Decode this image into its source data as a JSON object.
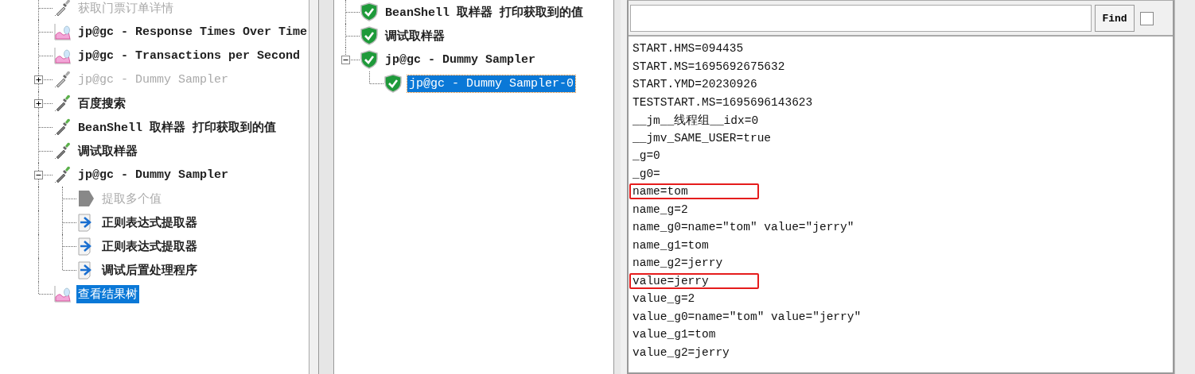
{
  "test_plan_tree": {
    "items": [
      {
        "kind": "dropper",
        "label": "获取门票订单详情",
        "disabled": true
      },
      {
        "kind": "chart",
        "label": "jp@gc - Response Times Over Time",
        "disabled": false
      },
      {
        "kind": "chart",
        "label": "jp@gc - Transactions per Second",
        "disabled": false
      },
      {
        "kind": "dropper",
        "label": "jp@gc - Dummy Sampler",
        "disabled": true,
        "expanded": false
      },
      {
        "kind": "dropper",
        "label": "百度搜索",
        "disabled": false,
        "expanded": false
      },
      {
        "kind": "dropper",
        "label": "BeanShell 取样器 打印获取到的值",
        "disabled": false
      },
      {
        "kind": "dropper",
        "label": "调试取样器",
        "disabled": false
      },
      {
        "kind": "dropper",
        "label": "jp@gc - Dummy Sampler",
        "disabled": false,
        "expanded": true,
        "children": [
          {
            "kind": "extractor",
            "label": "提取多个值",
            "disabled": true
          },
          {
            "kind": "extractor",
            "label": "正则表达式提取器",
            "disabled": false
          },
          {
            "kind": "extractor",
            "label": "正则表达式提取器",
            "disabled": false
          },
          {
            "kind": "extractor",
            "label": "调试后置处理程序",
            "disabled": false
          }
        ]
      },
      {
        "kind": "chart",
        "label": "查看结果树",
        "disabled": false,
        "selected": true
      }
    ]
  },
  "results_tree": {
    "items": [
      {
        "kind": "success",
        "label": "BeanShell 取样器 打印获取到的值"
      },
      {
        "kind": "success",
        "label": "调试取样器"
      },
      {
        "kind": "success",
        "label": "jp@gc - Dummy Sampler",
        "expanded": true,
        "children": [
          {
            "kind": "success",
            "label": "jp@gc - Dummy Sampler-0",
            "selected": true
          }
        ]
      }
    ]
  },
  "response_panel": {
    "search": {
      "button": "Find",
      "regex_checked": false
    },
    "lines": [
      {
        "text": "START.HMS=094435",
        "highlighted": false
      },
      {
        "text": "START.MS=1695692675632",
        "highlighted": false
      },
      {
        "text": "START.YMD=20230926",
        "highlighted": false
      },
      {
        "text": "TESTSTART.MS=1695696143623",
        "highlighted": false
      },
      {
        "text": "__jm__线程组__idx=0",
        "highlighted": false
      },
      {
        "text": "__jmv_SAME_USER=true",
        "highlighted": false
      },
      {
        "text": "_g=0",
        "highlighted": false
      },
      {
        "text": "_g0=",
        "highlighted": false
      },
      {
        "text": "name=tom",
        "highlighted": true
      },
      {
        "text": "name_g=2",
        "highlighted": false
      },
      {
        "text": "name_g0=name=\"tom\" value=\"jerry\"",
        "highlighted": false
      },
      {
        "text": "name_g1=tom",
        "highlighted": false
      },
      {
        "text": "name_g2=jerry",
        "highlighted": false
      },
      {
        "text": "value=jerry",
        "highlighted": true
      },
      {
        "text": "value_g=2",
        "highlighted": false
      },
      {
        "text": "value_g0=name=\"tom\" value=\"jerry\"",
        "highlighted": false
      },
      {
        "text": "value_g1=tom",
        "highlighted": false
      },
      {
        "text": "value_g2=jerry",
        "highlighted": false
      }
    ]
  }
}
